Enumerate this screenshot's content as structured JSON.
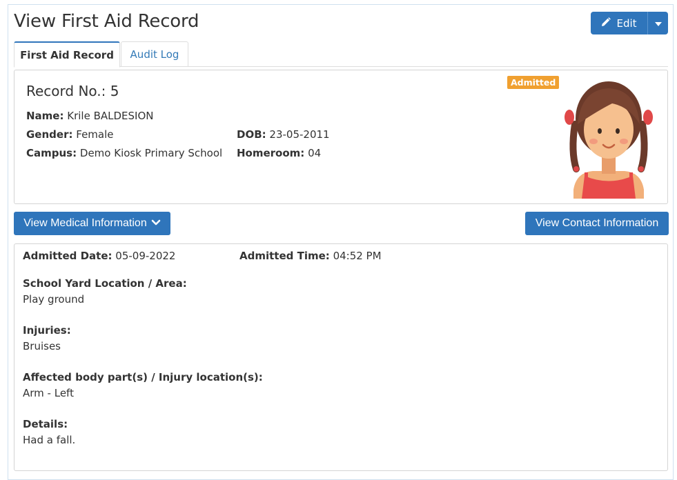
{
  "page": {
    "title": "View First Aid Record",
    "edit_label": "Edit"
  },
  "tabs": [
    {
      "label": "First Aid Record",
      "active": true
    },
    {
      "label": "Audit Log",
      "active": false
    }
  ],
  "record": {
    "record_no_label": "Record No.:",
    "record_no": "5",
    "status_badge": "Admitted",
    "status_color": "#f0a030",
    "name_label": "Name:",
    "name": "Krile BALDESION",
    "gender_label": "Gender:",
    "gender": "Female",
    "dob_label": "DOB:",
    "dob": "23-05-2011",
    "campus_label": "Campus:",
    "campus": "Demo Kiosk Primary School",
    "homeroom_label": "Homeroom:",
    "homeroom": "04"
  },
  "actions": {
    "medical_label": "View Medical Information",
    "contact_label": "View Contact Information"
  },
  "details": {
    "admitted_date_label": "Admitted Date:",
    "admitted_date": "05-09-2022",
    "admitted_time_label": "Admitted Time:",
    "admitted_time": "04:52 PM",
    "location_label": "School Yard Location / Area:",
    "location": "Play ground",
    "injuries_label": "Injuries:",
    "injuries": "Bruises",
    "body_part_label": "Affected body part(s) / Injury location(s):",
    "body_part": "Arm - Left",
    "details_label": "Details:",
    "details": "Had a fall."
  },
  "colors": {
    "primary": "#2f75bb",
    "link": "#337ab7",
    "badge": "#f0a030"
  }
}
